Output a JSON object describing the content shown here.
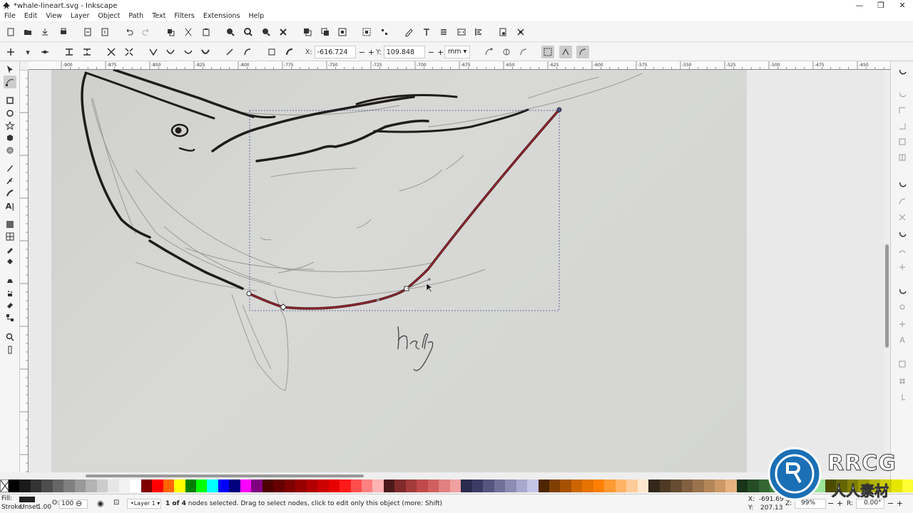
{
  "window": {
    "title": "*whale-lineart.svg - Inkscape",
    "controls": [
      "—",
      "❐",
      "✕"
    ]
  },
  "menubar": [
    "File",
    "Edit",
    "View",
    "Layer",
    "Object",
    "Path",
    "Text",
    "Filters",
    "Extensions",
    "Help"
  ],
  "tool_controls": {
    "x_label": "X:",
    "x_value": "-616.724",
    "y_label": "Y:",
    "y_value": "109.848",
    "pm": "−+",
    "unit": "mm ▾"
  },
  "ruler_ticks": [
    "-900",
    "-875",
    "-850",
    "-825",
    "-800",
    "-775",
    "-750",
    "-725",
    "-700",
    "-675",
    "-650",
    "-625",
    "-600",
    "-575",
    "-550",
    "-525",
    "-500",
    "-475",
    "-450"
  ],
  "canvas": {
    "handwriting": "hefe"
  },
  "statusbar": {
    "fill_label": "Fill:",
    "stroke_label": "Stroke:",
    "stroke_value": "Unset",
    "stroke_width": "1.00",
    "opacity_label": "O:",
    "opacity_value": "100",
    "layer": "•Layer 1",
    "message_bold": "1 of 4",
    "message": " nodes selected. Drag to select nodes, click to edit only this object (more: Shift)",
    "x_label": "X:",
    "x_value": "-691.69",
    "y_label": "Y:",
    "y_value": "207.13",
    "zoom_label": "Z:",
    "zoom_value": "99%",
    "rotate_label": "R:",
    "rotate_value": "0.00°"
  },
  "palette": [
    "#000000",
    "#1a1a1a",
    "#333333",
    "#4d4d4d",
    "#666666",
    "#808080",
    "#999999",
    "#b3b3b3",
    "#cccccc",
    "#e6e6e6",
    "#f2f2f2",
    "#ffffff",
    "#800000",
    "#ff0000",
    "#ff6600",
    "#ffff00",
    "#008000",
    "#00ff00",
    "#00ffff",
    "#0000ff",
    "#000080",
    "#ff00ff",
    "#800080",
    "#4d0000",
    "#660000",
    "#800000",
    "#990000",
    "#b30000",
    "#cc0000",
    "#e60000",
    "#ff1a1a",
    "#ff4d4d",
    "#ff8080",
    "#ffb3b3",
    "#4d1a1a",
    "#802b2b",
    "#a33b3b",
    "#c04a4a",
    "#d06060",
    "#e08080",
    "#f0a0a0",
    "#2b2b4d",
    "#3b3b66",
    "#55557f",
    "#707099",
    "#8c8cb3",
    "#a8a8cc",
    "#c4c4e6",
    "#4d2600",
    "#803f00",
    "#a65200",
    "#cc6600",
    "#e67300",
    "#ff8000",
    "#ff9933",
    "#ffb366",
    "#ffcc99",
    "#ffe6cc",
    "#33261a",
    "#4d3926",
    "#664d33",
    "#806040",
    "#99734d",
    "#b3875a",
    "#cc9966",
    "#e6b380",
    "#1a331a",
    "#264d26",
    "#336633",
    "#408040",
    "#4d994d",
    "#66b366",
    "#80cc80",
    "#99e699",
    "#4d4d00",
    "#666600",
    "#808000",
    "#999900",
    "#b3b300",
    "#cccc00",
    "#e6e600",
    "#ffff33"
  ],
  "logo": {
    "line1": "RRCG",
    "line2": "人人素材"
  }
}
